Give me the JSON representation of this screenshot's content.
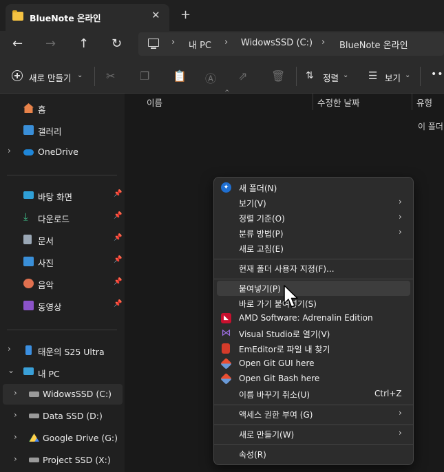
{
  "tab": {
    "title": "BlueNote 온라인",
    "close": "✕",
    "new_tab": "+"
  },
  "nav": {
    "back": "←",
    "forward": "→",
    "up": "↑",
    "refresh": "↻"
  },
  "breadcrumb": [
    "내 PC",
    "WidowsSSD (C:)",
    "BlueNote 온라인"
  ],
  "toolbar": {
    "new_label": "새로 만들기",
    "sort_label": "정렬",
    "view_label": "보기",
    "more": "•••"
  },
  "sidebar": {
    "home": "홈",
    "gallery": "갤러리",
    "onedrive": "OneDrive",
    "quick": [
      "바탕 화면",
      "다운로드",
      "문서",
      "사진",
      "음악",
      "동영상"
    ],
    "phone": "태운의 S25 Ultra",
    "this_pc": "내 PC",
    "drives": [
      "WidowsSSD (C:)",
      "Data SSD (D:)",
      "Google Drive (G:)",
      "Project SSD (X:)"
    ]
  },
  "columns": {
    "name": "이름",
    "modified": "수정한 날짜",
    "type": "유형",
    "empty_partial": "이 폴더"
  },
  "context_menu": {
    "new_folder": "새 폴더(N)",
    "view": "보기(V)",
    "sort_by": "정렬 기준(O)",
    "group_by": "분류 방법(P)",
    "refresh": "새로 고침(E)",
    "customize": "현재 폴더 사용자 지정(F)...",
    "paste": "붙여넣기(P)",
    "paste_shortcut": "바로 가기 붙여넣기(S)",
    "amd": "AMD Software: Adrenalin Edition",
    "vs": "Visual Studio로 열기(V)",
    "emeditor": "EmEditor로 파일 내 찾기",
    "git_gui": "Open Git GUI here",
    "git_bash": "Open Git Bash here",
    "undo_rename": "이름 바꾸기 취소(U)",
    "undo_shortcut": "Ctrl+Z",
    "access": "액세스 권한 부여 (G)",
    "new": "새로 만들기(W)",
    "properties": "속성(R)"
  },
  "colors": {
    "accent": "#0078d4",
    "menu_bg": "#2c2c2c",
    "sidebar_bg": "#202020"
  }
}
